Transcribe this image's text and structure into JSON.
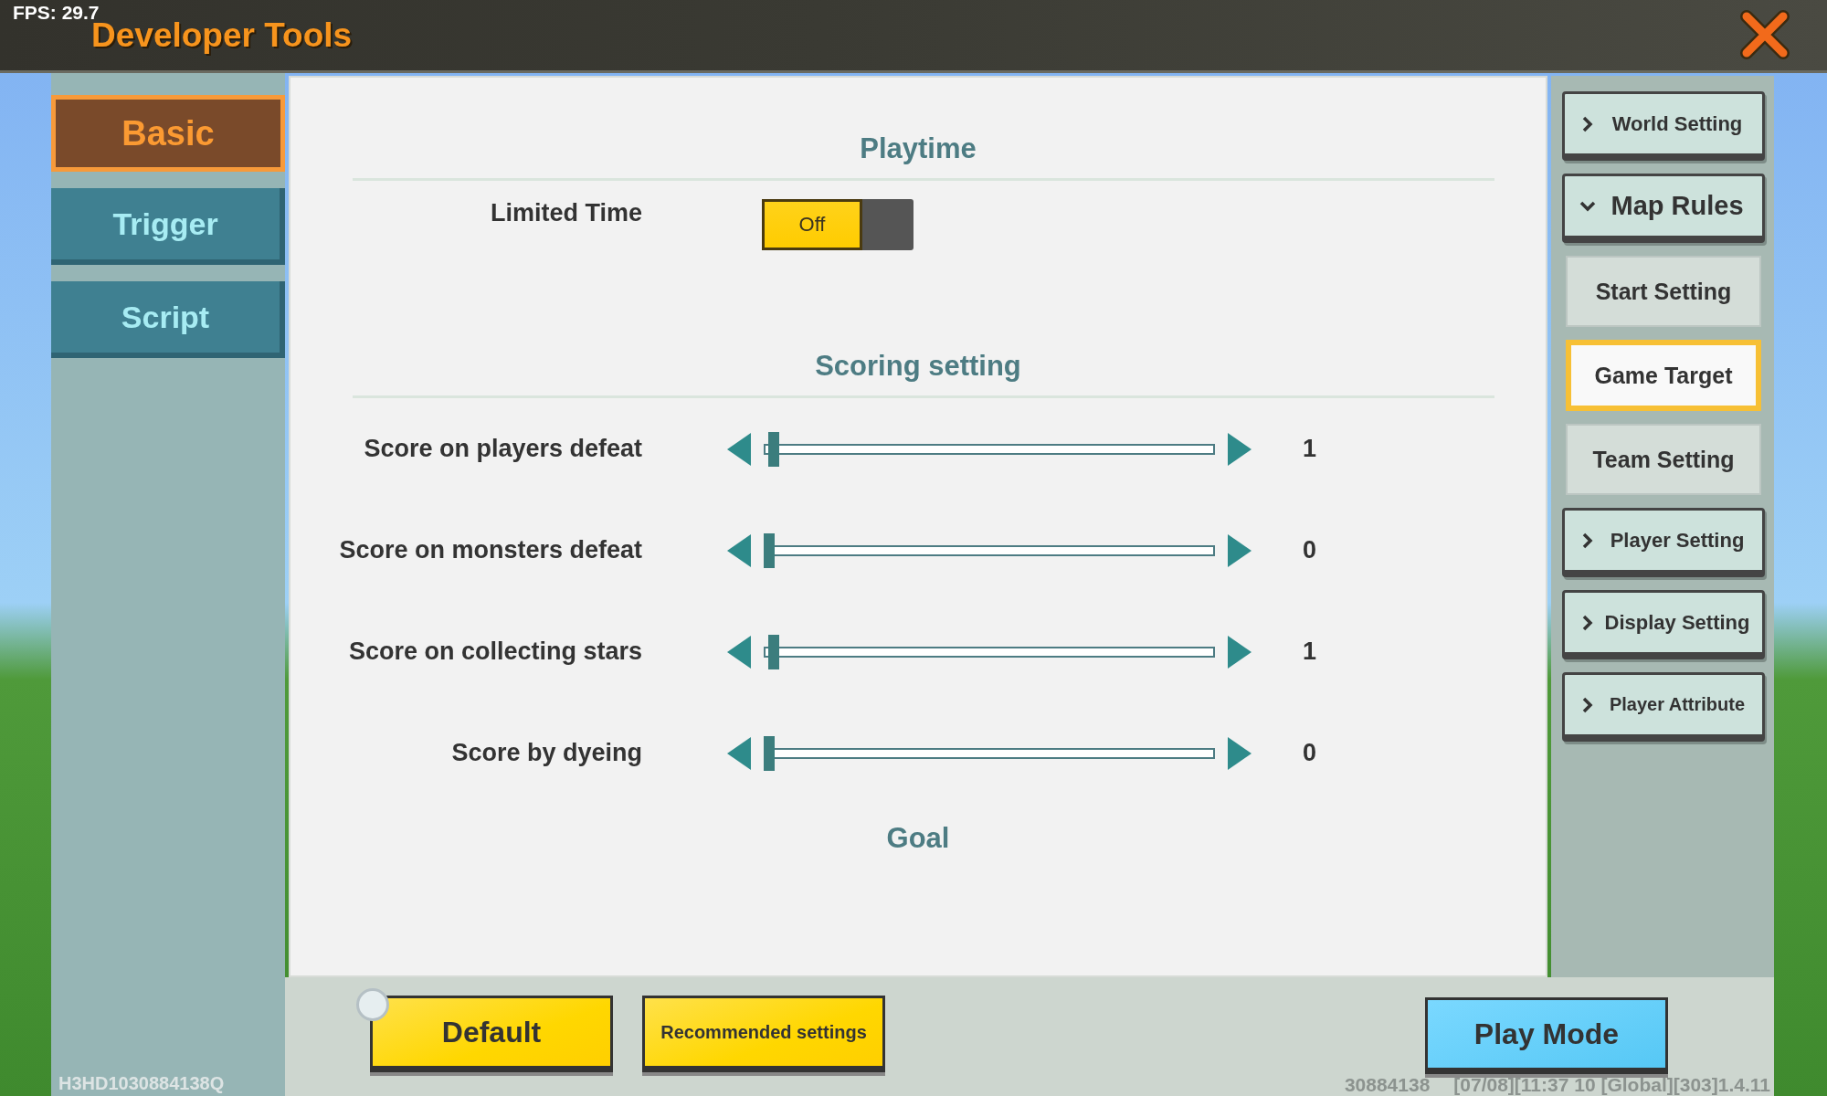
{
  "fps": "FPS: 29.7",
  "title": "Developer Tools",
  "sidebar": {
    "tabs": [
      {
        "label": "Basic",
        "selected": true
      },
      {
        "label": "Trigger",
        "selected": false
      },
      {
        "label": "Script",
        "selected": false
      }
    ],
    "device_id": "H3HD1030884138Q"
  },
  "sections": [
    {
      "kind": "heading",
      "text": "Playtime"
    },
    {
      "kind": "toggle",
      "label": "Limited Time",
      "on": false,
      "state_text": "Off"
    },
    {
      "kind": "heading",
      "text": "Scoring setting"
    },
    {
      "kind": "slider",
      "label": "Score on players defeat",
      "level": 0.01,
      "reading": "1"
    },
    {
      "kind": "slider",
      "label": "Score on monsters defeat",
      "level": 0,
      "reading": "0"
    },
    {
      "kind": "slider",
      "label": "Score on collecting stars",
      "level": 0.01,
      "reading": "1"
    },
    {
      "kind": "slider",
      "label": "Score by dyeing",
      "level": 0,
      "reading": "0"
    },
    {
      "kind": "heading",
      "text": "Goal"
    }
  ],
  "menu": [
    {
      "kind": "group",
      "label": "World Setting",
      "expanded": false
    },
    {
      "kind": "group",
      "label": "Map Rules",
      "expanded": true
    },
    {
      "kind": "sub",
      "label": "Start Setting",
      "selected": false
    },
    {
      "kind": "sub",
      "label": "Game Target",
      "selected": true
    },
    {
      "kind": "sub",
      "label": "Team Setting",
      "selected": false
    },
    {
      "kind": "group",
      "label": "Player Setting",
      "expanded": false
    },
    {
      "kind": "group",
      "label": "Display Setting",
      "expanded": false
    },
    {
      "kind": "group",
      "label": "Player Attribute",
      "expanded": false
    }
  ],
  "buttons": [
    {
      "label": "Default",
      "kind": "yellow"
    },
    {
      "label": "Recommended settings",
      "kind": "yellow"
    },
    {
      "label": "Play Mode",
      "kind": "blue"
    }
  ],
  "footer": [
    "30884138",
    "[07/08][11:37 10 [Global][303]1.4.11"
  ]
}
